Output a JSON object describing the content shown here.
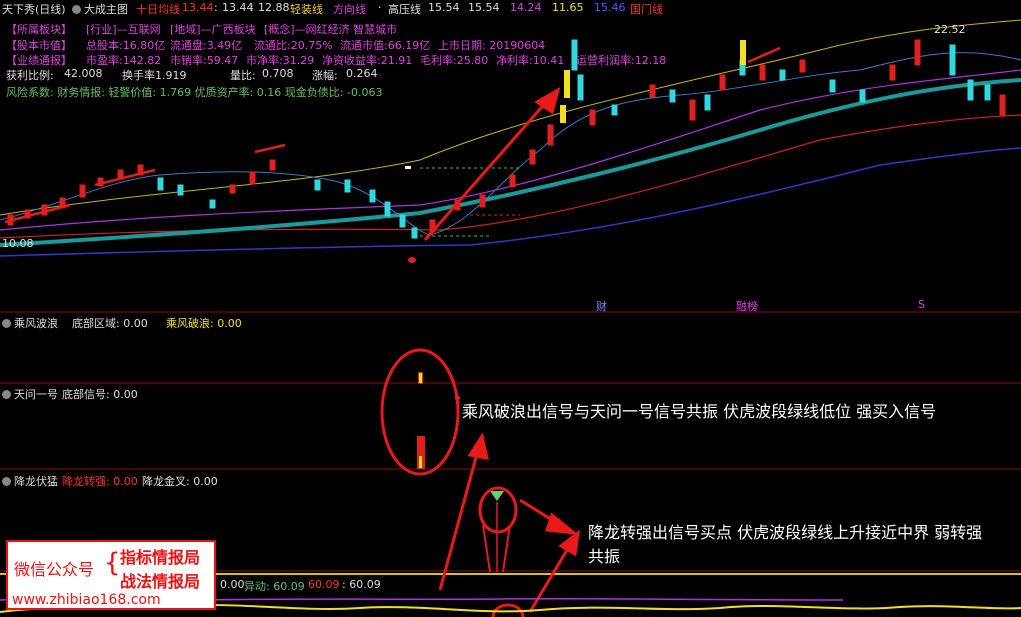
{
  "topbar": {
    "stock_name": "天下秀(日线)",
    "indicator_name": "大成主图",
    "ma10_label": "十日均线",
    "ma10_val": "13.44",
    "v2": "13.44",
    "v3": "12.88",
    "qz_label": "轻装线",
    "fx_label": "方向线",
    "gy_label": "高压线",
    "gy_v1": "15.54",
    "gy_v2": "15.54",
    "v4": "14.24",
    "v5": "11.65",
    "v6": "15.46",
    "gm_label": "国门线"
  },
  "info": {
    "r1": [
      "【所属板块】",
      "[行业]—互联网",
      "[地域]—广西板块",
      "[概念]—网红经济  智慧城市"
    ],
    "r2": [
      "【股本市值】",
      "总股本:16.80亿",
      "流通盘:3.49亿",
      "流通比:20.75%",
      "流通市值:66.19亿",
      "上市日期: 20190604"
    ],
    "r3": [
      "【业绩通报】",
      "市盈率:142.82",
      "市销率:59.47",
      "市净率:31.29",
      "净资收益率:21.91",
      "毛利率:25.80",
      "净利率:10.41"
    ],
    "r4": [
      "获利比例:",
      "42.008",
      "换手率1.919",
      "量比:",
      "0.708",
      "涨幅:",
      "0.264"
    ],
    "r5": "风险系数: 财务情报: 轻警价值: 1.769 优质资产率: 0.16 现金负债比: -0.063"
  },
  "chart_labels": {
    "high": "22.52",
    "low": "10.08",
    "warn": "运营利润率:12.18",
    "cai": "财",
    "jin": "融榜",
    "s": "S"
  },
  "panel1": {
    "name": "乘风波浪",
    "a_label": "底部区域: 0.00",
    "b_label": "乘风破浪: 0.00"
  },
  "panel2": {
    "name": "天问一号",
    "a_label": "底部信号: 0.00"
  },
  "panel3": {
    "name": "降龙伏猛",
    "a_label": "降龙转强: 0.00",
    "b_label": "降龙金叉: 0.00"
  },
  "panel4": {
    "a": "0.00",
    "b_label": "异动: 60.09",
    "c": "60.09",
    "d": ": 60.09"
  },
  "annotations": {
    "a1": "乘风破浪出信号与天问一号信号共振  伏虎波段绿线低位 强买入信号",
    "a2_l1": "降龙转强出信号买点  伏虎波段绿线上升接近中界  弱转强",
    "a2_l2": "共振"
  },
  "watermark": {
    "wx": "微信公众号",
    "t1": "指标情报局",
    "t2": "战法情报局",
    "url": "www.zhibiao168.com"
  }
}
